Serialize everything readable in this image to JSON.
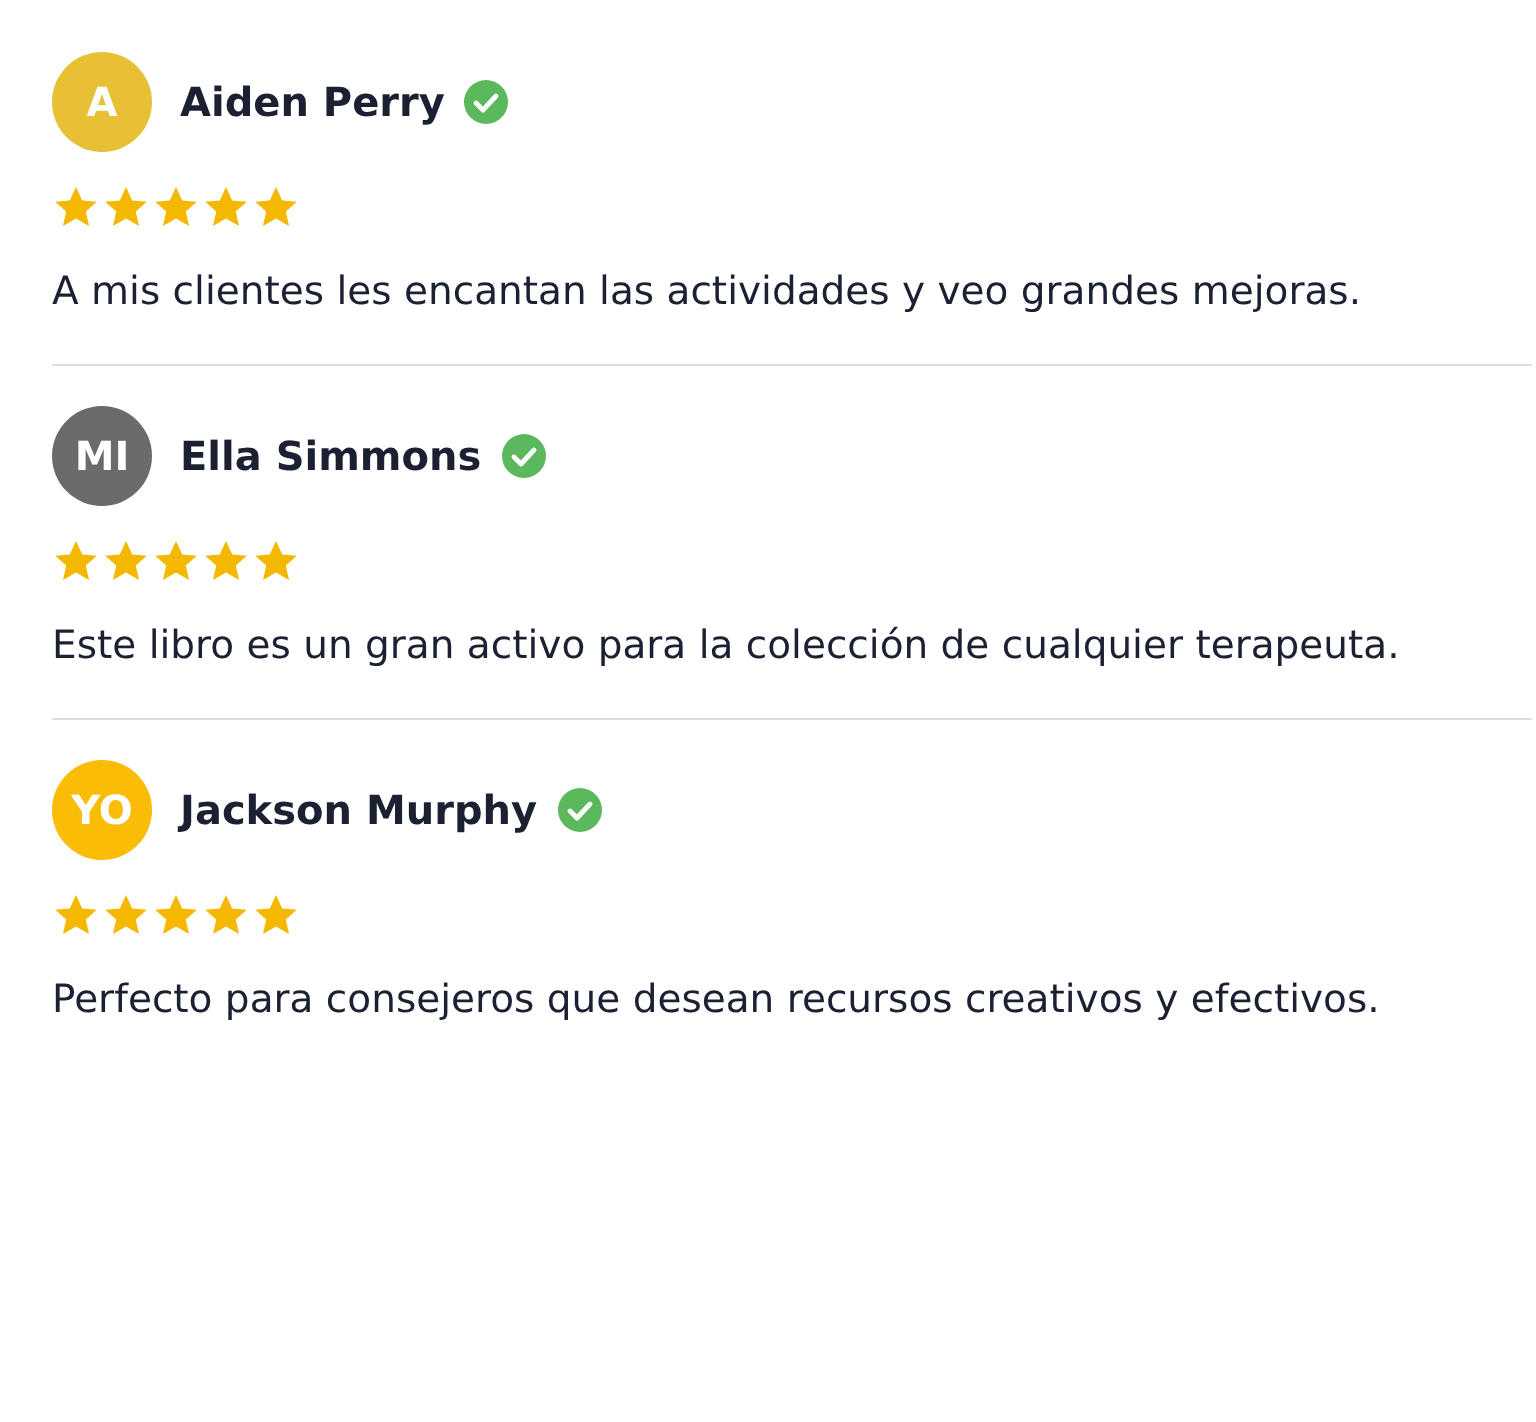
{
  "reviews": [
    {
      "initials": "A",
      "color": "#e8c033",
      "name": "Aiden Perry",
      "verified": true,
      "stars": 5,
      "text": "A mis clientes les encantan las actividades y veo grandes mejoras."
    },
    {
      "initials": "MI",
      "color": "#6b6b6b",
      "name": "Ella Simmons",
      "verified": true,
      "stars": 5,
      "text": "Este libro es un gran activo para la colección de cualquier terapeuta."
    },
    {
      "initials": "YO",
      "color": "#fbbc05",
      "name": "Jackson Murphy",
      "verified": true,
      "stars": 5,
      "text": "Perfecto para consejeros que desean recursos creativos y efectivos."
    }
  ]
}
